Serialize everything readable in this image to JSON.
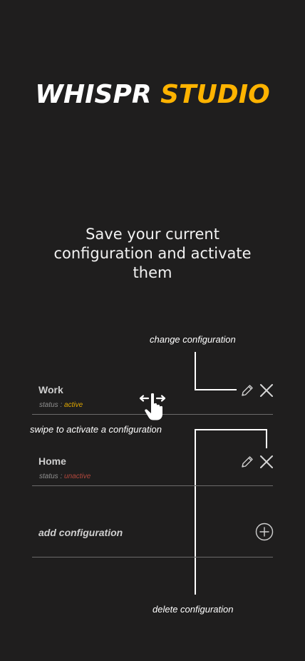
{
  "app": {
    "logo_word_1": "WHISPR",
    "logo_word_2": "STUDIO",
    "brand_color": "#ffb300",
    "background_color": "#1f1e1e"
  },
  "tagline": "Save your current configuration and activate them",
  "configurations": [
    {
      "name": "Work",
      "status_prefix": "status : ",
      "status_value": "active",
      "status_color": "#e0a800",
      "edit_icon": "pencil-icon",
      "delete_icon": "close-icon"
    },
    {
      "name": "Home",
      "status_prefix": "status : ",
      "status_value": "unactive",
      "status_color": "#b2473c",
      "edit_icon": "pencil-icon",
      "delete_icon": "close-icon"
    }
  ],
  "add_configuration": {
    "label": "add configuration",
    "icon": "plus-circle-icon"
  },
  "annotations": {
    "change": "change configuration",
    "swipe": "swipe to activate a configuration",
    "delete": "delete configuration",
    "swipe_icon": "swipe-hand-icon"
  }
}
